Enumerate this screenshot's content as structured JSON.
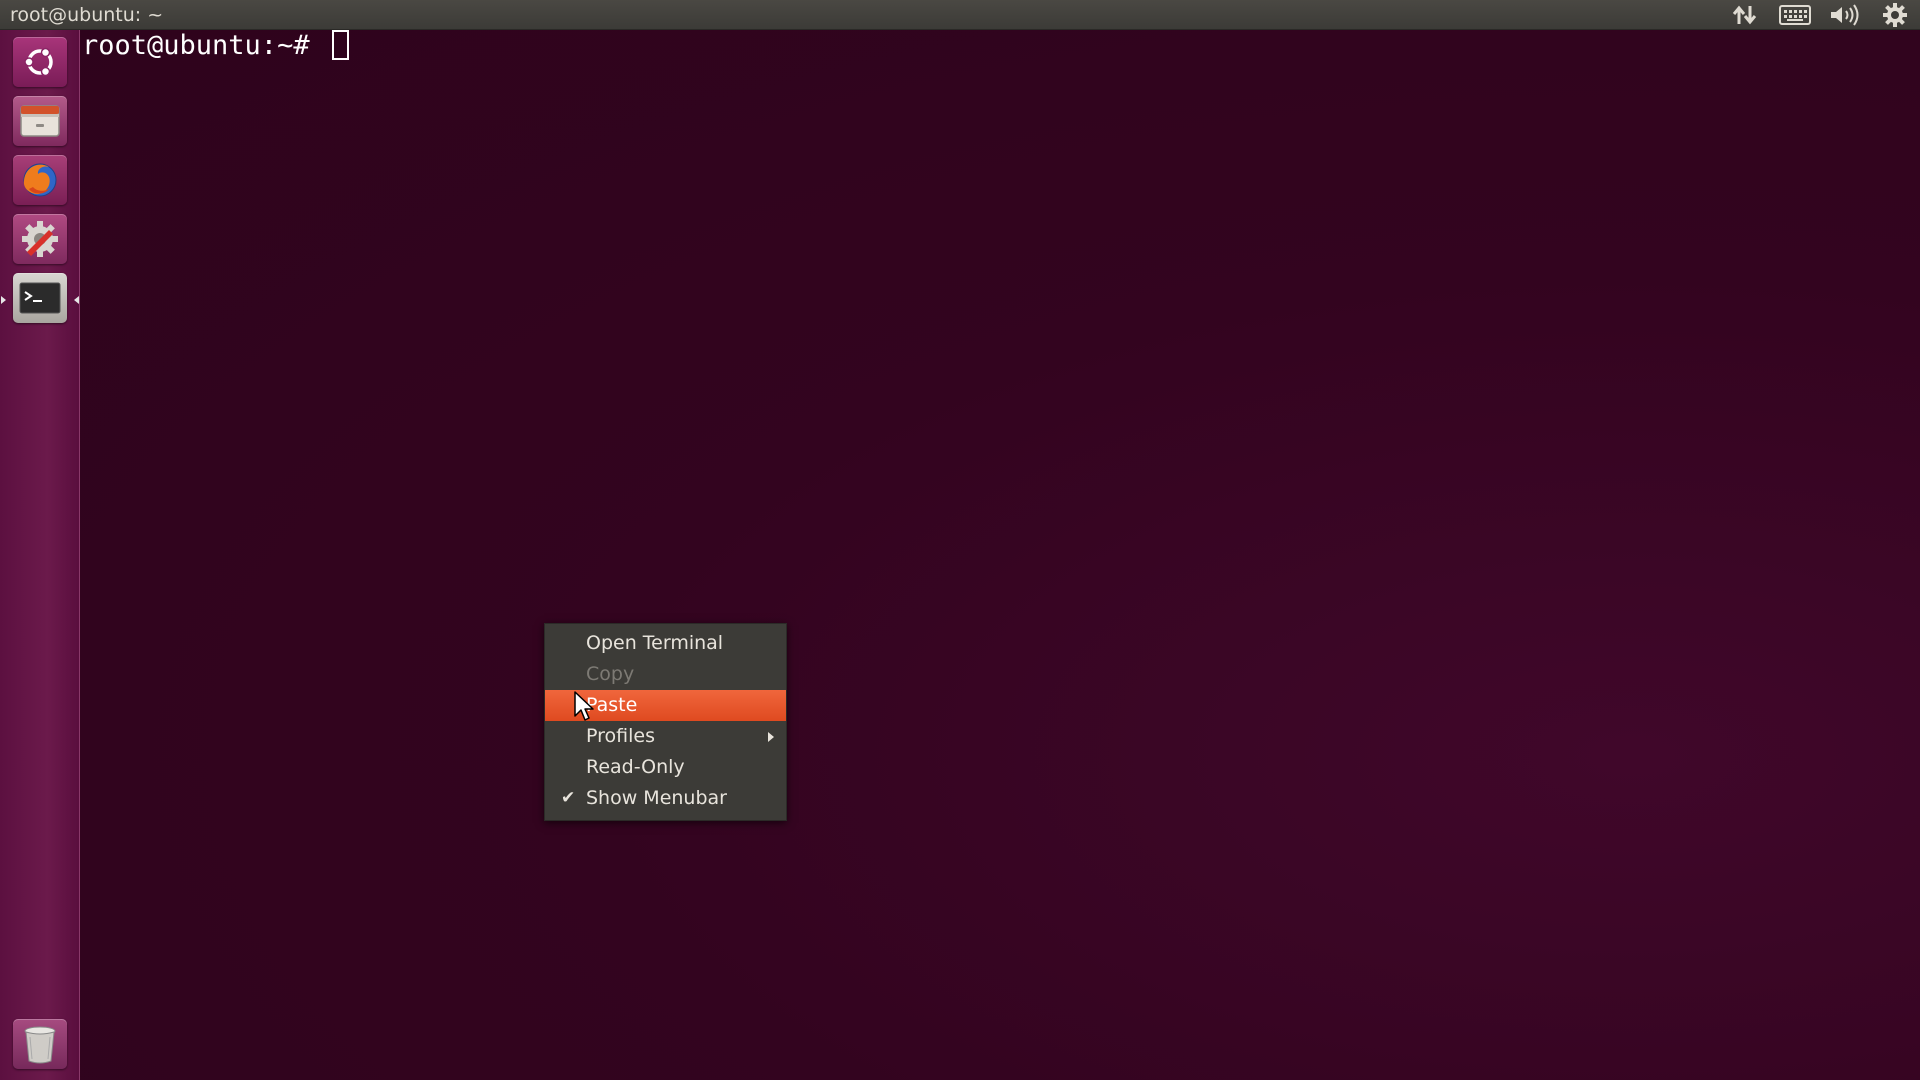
{
  "top_panel": {
    "window_title": "root@ubuntu: ~",
    "indicators": [
      {
        "icon": "network-transfer-icon"
      },
      {
        "icon": "keyboard-icon"
      },
      {
        "icon": "volume-icon"
      },
      {
        "icon": "session-gear-icon"
      }
    ]
  },
  "launcher": {
    "items": [
      {
        "name": "dash-home",
        "icon": "ubuntu-logo-icon"
      },
      {
        "name": "files",
        "icon": "file-cabinet-icon"
      },
      {
        "name": "firefox",
        "icon": "firefox-icon"
      },
      {
        "name": "system-settings",
        "icon": "settings-wrench-icon"
      },
      {
        "name": "terminal",
        "icon": "terminal-icon",
        "running": true
      },
      {
        "name": "trash",
        "icon": "trash-icon"
      }
    ]
  },
  "terminal": {
    "prompt": "root@ubuntu:~# "
  },
  "context_menu": {
    "items": [
      {
        "label": "Open Terminal",
        "enabled": true
      },
      {
        "label": "Copy",
        "enabled": false
      },
      {
        "label": "Paste",
        "enabled": true,
        "highlighted": true
      },
      {
        "label": "Profiles",
        "enabled": true,
        "submenu": true
      },
      {
        "label": "Read-Only",
        "enabled": true
      },
      {
        "label": "Show Menubar",
        "enabled": true,
        "checked": true,
        "check_glyph": "✔"
      }
    ]
  },
  "colors": {
    "desktop_bg": "#33041f",
    "panel_bg": "#3c3b37",
    "launcher_bg": "#6b1a4b",
    "menu_bg": "#3c3b37",
    "menu_highlight": "#df4a20",
    "text_light": "#dfdbd2"
  }
}
